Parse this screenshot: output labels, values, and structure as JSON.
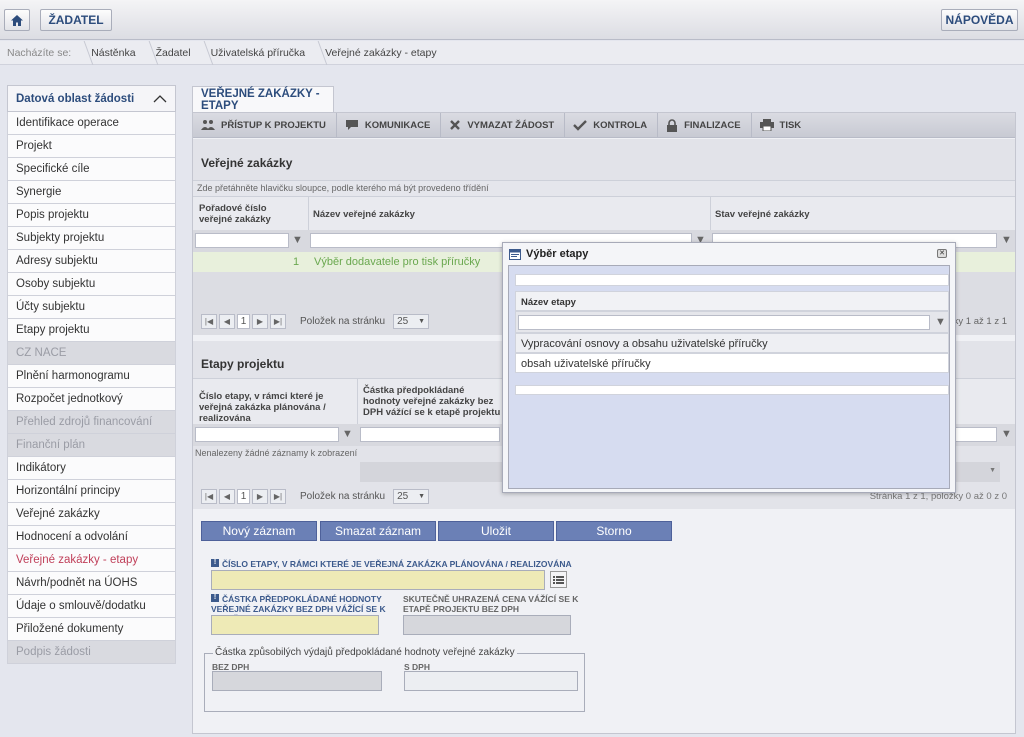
{
  "topbar": {
    "zadatel_label": "ŽADATEL",
    "help_label": "NÁPOVĚDA"
  },
  "breadcrumb": {
    "lead": "Nacházíte se:",
    "items": [
      "Nástěnka",
      "Žadatel",
      "Uživatelská příručka",
      "Veřejné zakázky - etapy"
    ]
  },
  "sidebar": {
    "title": "Datová oblast žádosti",
    "items": [
      {
        "label": "Identifikace operace"
      },
      {
        "label": "Projekt"
      },
      {
        "label": "Specifické cíle"
      },
      {
        "label": "Synergie"
      },
      {
        "label": "Popis projektu"
      },
      {
        "label": "Subjekty projektu"
      },
      {
        "label": "Adresy subjektu"
      },
      {
        "label": "Osoby subjektu"
      },
      {
        "label": "Účty subjektu"
      },
      {
        "label": "Etapy projektu"
      },
      {
        "label": "CZ NACE"
      },
      {
        "label": "Plnění harmonogramu"
      },
      {
        "label": "Rozpočet jednotkový"
      },
      {
        "label": "Přehled zdrojů financování"
      },
      {
        "label": "Finanční plán"
      },
      {
        "label": "Indikátory"
      },
      {
        "label": "Horizontální principy"
      },
      {
        "label": "Veřejné zakázky"
      },
      {
        "label": "Hodnocení a odvolání"
      },
      {
        "label": "Veřejné zakázky - etapy"
      },
      {
        "label": "Návrh/podnět na ÚOHS"
      },
      {
        "label": "Údaje o smlouvě/dodatku"
      },
      {
        "label": "Přiložené dokumenty"
      },
      {
        "label": "Podpis žádosti"
      }
    ]
  },
  "main": {
    "tab_title": "VEŘEJNÉ ZAKÁZKY - ETAPY",
    "toolbar": [
      {
        "label": "PŘÍSTUP K PROJEKTU"
      },
      {
        "label": "KOMUNIKACE"
      },
      {
        "label": "VYMAZAT ŽÁDOST"
      },
      {
        "label": "KONTROLA"
      },
      {
        "label": "FINALIZACE"
      },
      {
        "label": "TISK"
      }
    ],
    "vz": {
      "title": "Veřejné zakázky",
      "hint": "Zde přetáhněte hlavičku sloupce, podle kterého má být provedeno třídění",
      "col1": "Pořadové číslo veřejné zakázky",
      "col2": "Název veřejné zakázky",
      "col3": "Stav veřejné zakázky",
      "row_num": "1",
      "row_name": "Výběr dodavatele pro tisk příručky",
      "pager_page": "1",
      "pager_label": "Položek na stránku",
      "pager_size": "25",
      "pager_info": "položky 1 až 1 z 1"
    },
    "ep": {
      "title": "Etapy projektu",
      "col1": "Číslo etapy, v rámci které je veřejná zakázka plánována / realizována",
      "col2": "Částka předpokládané hodnoty veřejné zakázky bez DPH vážící se k etapě projektu",
      "empty": "Nenalezeny žádné záznamy k zobrazení",
      "pager_page": "1",
      "pager_label": "Položek na stránku",
      "pager_size": "25",
      "pager_info": "Stránka 1 z 1, položky 0 až 0 z 0"
    },
    "buttons": {
      "new": "Nový záznam",
      "delete": "Smazat záznam",
      "save": "Uložit",
      "cancel": "Storno"
    },
    "form": {
      "etapa_label": "ČÍSLO ETAPY, V RÁMCI KTERÉ JE VEŘEJNÁ ZAKÁZKA PLÁNOVÁNA / REALIZOVÁNA",
      "castka_label": "ČÁSTKA PŘEDPOKLÁDANÉ HODNOTY VEŘEJNÉ ZAKÁZKY BEZ DPH VÁŽÍCÍ SE K ETAPĚ PROJEKTU",
      "skutecne_label": "SKUTEČNĚ UHRAZENÁ CENA VÁŽÍCÍ SE K ETAPĚ PROJEKTU BEZ DPH",
      "group_legend": "Částka způsobilých výdajů předpokládané hodnoty veřejné zakázky",
      "bez_dph": "BEZ DPH",
      "s_dph": "S DPH"
    }
  },
  "modal": {
    "title": "Výběr etapy",
    "col_header": "Název etapy",
    "rows": [
      "Vypracování osnovy a obsahu uživatelské příručky",
      "obsah uživatelské příručky"
    ]
  },
  "colors": {
    "accent_blue": "#2c4c7c",
    "button_blue": "#6b80b6",
    "active_red": "#c0405a",
    "link_green": "#6aa84f",
    "required_yellow": "#eeeab6"
  }
}
